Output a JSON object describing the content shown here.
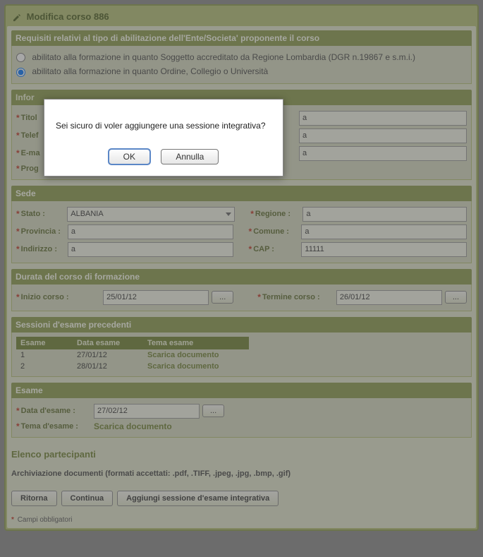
{
  "page_title": "Modifica corso 886",
  "requisiti": {
    "header": "Requisiti relativi al tipo di abilitazione dell'Ente/Societa' proponente il corso",
    "opt1": "abilitato alla formazione in quanto Soggetto accreditato da Regione Lombardia (DGR n.19867 e s.m.i.)",
    "opt2": "abilitato alla formazione in quanto Ordine, Collegio o Università"
  },
  "info": {
    "titolo": {
      "label": "Titol",
      "value": "a"
    },
    "telef": {
      "label": "Telef",
      "value": "a"
    },
    "email": {
      "label": "E-ma",
      "value": "a"
    },
    "progr": {
      "label": "Prog"
    },
    "hlabel_right": "a"
  },
  "sede": {
    "header": "Sede",
    "stato": {
      "label": "Stato :",
      "value": "ALBANIA"
    },
    "regione": {
      "label": "Regione :",
      "value": "a"
    },
    "provincia": {
      "label": "Provincia :",
      "value": "a"
    },
    "comune": {
      "label": "Comune :",
      "value": "a"
    },
    "indirizzo": {
      "label": "Indirizzo :",
      "value": "a"
    },
    "cap": {
      "label": "CAP :",
      "value": "11111"
    }
  },
  "durata": {
    "header": "Durata del corso di formazione",
    "inizio": {
      "label": "Inizio corso :",
      "value": "25/01/12"
    },
    "termine": {
      "label": "Termine corso :",
      "value": "26/01/12"
    },
    "picker": "..."
  },
  "sessioni": {
    "header": "Sessioni d'esame precedenti",
    "cols": {
      "esame": "Esame",
      "data": "Data esame",
      "tema": "Tema esame"
    },
    "rows": [
      {
        "n": "1",
        "data": "27/01/12",
        "link": "Scarica documento"
      },
      {
        "n": "2",
        "data": "28/01/12",
        "link": "Scarica documento"
      }
    ]
  },
  "esame": {
    "header": "Esame",
    "data": {
      "label": "Data d'esame :",
      "value": "27/02/12",
      "picker": "..."
    },
    "tema": {
      "label": "Tema d'esame :",
      "link": "Scarica documento"
    }
  },
  "elenco": {
    "header": "Elenco partecipanti"
  },
  "archivio": "Archiviazione documenti (formati accettati: .pdf, .TIFF, .jpeg, .jpg, .bmp, .gif)",
  "buttons": {
    "ritorna": "Ritorna",
    "continua": "Continua",
    "aggiungi": "Aggiungi sessione d'esame integrativa"
  },
  "footnote": "Campi obbligatori",
  "dialog": {
    "message": "Sei sicuro di voler aggiungere una sessione integrativa?",
    "ok": "OK",
    "cancel": "Annulla"
  }
}
